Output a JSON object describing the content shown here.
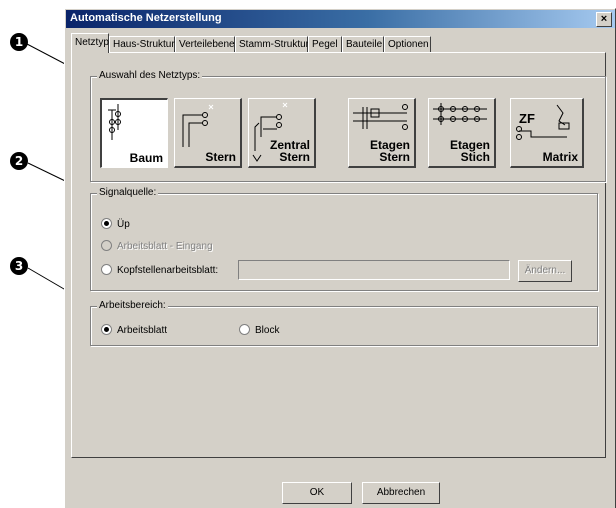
{
  "callouts": [
    "1",
    "2",
    "3"
  ],
  "window": {
    "title": "Automatische Netzerstellung",
    "close_glyph": "×"
  },
  "tabs": [
    {
      "label": "Netztyp",
      "active": true
    },
    {
      "label": "Haus-Struktur"
    },
    {
      "label": "Verteilebene"
    },
    {
      "label": "Stamm-Struktur"
    },
    {
      "label": "Pegel"
    },
    {
      "label": "Bauteile"
    },
    {
      "label": "Optionen"
    }
  ],
  "network_type": {
    "group_label": "Auswahl des Netztyps:",
    "buttons": [
      {
        "line1": "",
        "line2": "Baum",
        "icon": "tree-network-icon",
        "selected": true
      },
      {
        "line1": "",
        "line2": "Stern",
        "icon": "star-network-icon"
      },
      {
        "line1": "Zentral",
        "line2": "Stern",
        "icon": "central-star-network-icon"
      },
      {
        "line1": "Etagen",
        "line2": "Stern",
        "icon": "floor-star-network-icon"
      },
      {
        "line1": "Etagen",
        "line2": "Stich",
        "icon": "floor-branch-network-icon"
      },
      {
        "line1": "",
        "line2": "Matrix",
        "icon": "matrix-network-icon",
        "prefix": "ZF"
      }
    ]
  },
  "signal_source": {
    "group_label": "Signalquelle:",
    "options": [
      {
        "label": "Üp",
        "checked": true,
        "disabled": false
      },
      {
        "label": "Arbeitsblatt - Eingang",
        "checked": false,
        "disabled": true
      },
      {
        "label": "Kopfstellenarbeitsblatt:",
        "checked": false,
        "disabled": false
      }
    ],
    "headend_value": "",
    "change_button": "Ändern..."
  },
  "work_area": {
    "group_label": "Arbeitsbereich:",
    "options": [
      {
        "label": "Arbeitsblatt",
        "checked": true
      },
      {
        "label": "Block",
        "checked": false
      }
    ]
  },
  "footer": {
    "ok_label": "OK",
    "cancel_label": "Abbrechen"
  },
  "colors": {
    "dialog_face": "#d4d0c8",
    "title_gradient_start": "#0a246a",
    "title_gradient_end": "#a6caf0",
    "icon_stroke": "#000000"
  }
}
